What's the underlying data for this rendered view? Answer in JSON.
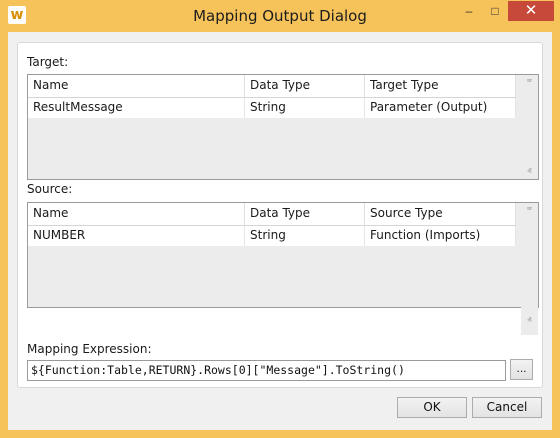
{
  "window": {
    "title": "Mapping Output Dialog",
    "app_icon_glyph": "w",
    "minimize_glyph": "–",
    "maximize_glyph": "□",
    "close_glyph": "✕",
    "accent": "#f6c35b",
    "close_color": "#c7493a"
  },
  "target": {
    "label": "Target:",
    "columns": [
      "Name",
      "Data Type",
      "Target Type"
    ],
    "rows": [
      [
        "ResultMessage",
        "String",
        "Parameter (Output)"
      ]
    ]
  },
  "source": {
    "label": "Source:",
    "columns": [
      "Name",
      "Data Type",
      "Source Type"
    ],
    "rows": [
      [
        "NUMBER",
        "String",
        "Function (Imports)"
      ]
    ]
  },
  "mapping": {
    "label": "Mapping Expression:",
    "value": "${Function:Table,RETURN}.Rows[0][\"Message\"].ToString()",
    "browse_label": "..."
  },
  "buttons": {
    "ok": "OK",
    "cancel": "Cancel"
  },
  "icons": {
    "scroll_up": "ⱎ",
    "scroll_down": "ⱏ"
  }
}
